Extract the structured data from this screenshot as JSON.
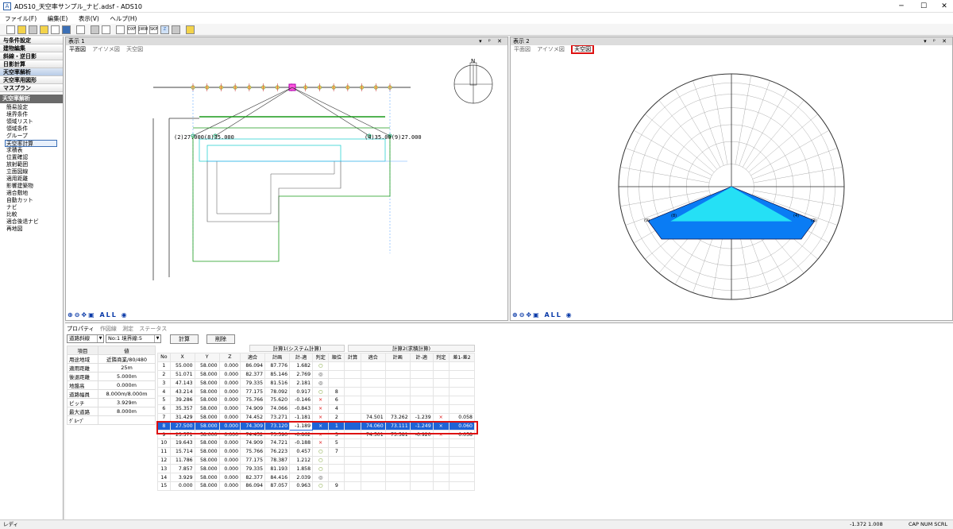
{
  "window": {
    "title": "ADS10_天空率サンプル_ナビ.adsf - ADS10",
    "app_icon": "A"
  },
  "menu": [
    "ファイル(F)",
    "編集(E)",
    "表示(V)",
    "ヘルプ(H)"
  ],
  "toolbar": {
    "labels": [
      "DXF",
      "JWW",
      "SKP",
      "Z"
    ]
  },
  "sidebar": {
    "headers": [
      "与条件設定",
      "建物編集",
      "斜線・逆日影",
      "日影計算",
      "天空率解析",
      "天空率用図形",
      "マスプラン"
    ],
    "section": "天空率解析",
    "items": [
      "簡易設定",
      "境界条件",
      "領域リスト",
      "領域条件",
      "グループ",
      "天空率計算",
      "求積表",
      "位置確認",
      "放射範囲",
      "立面図線",
      "適用距離",
      "影響建築物",
      "適合敷地",
      "自動カット",
      "ナビ",
      "比較",
      "適合後退ナビ",
      "再地図"
    ],
    "selected_index": 5
  },
  "view1": {
    "title": "表示 1",
    "tabs": [
      "平面図",
      "アイソメ図",
      "天空図"
    ],
    "active_tab": 0,
    "label_left": "(2)27.000(8)35.000",
    "label_right": "(4)35.00(9)27.000",
    "zoom_label": "ALL",
    "north": "N"
  },
  "view2": {
    "title": "表示 2",
    "tabs": [
      "平面図",
      "アイソメ図",
      "天空図"
    ],
    "active_tab": 2,
    "zoom_label": "ALL",
    "poly_labels": [
      "(9)",
      "(8)",
      "(4)",
      "(2)"
    ]
  },
  "props": {
    "tabs": [
      "プロパティ",
      "作図線",
      "測定",
      "ステータス"
    ],
    "combo1": "道路斜線",
    "combo2": "No:1 境界線:5",
    "calc_button": "計算",
    "delete_button": "削除",
    "left_headers": [
      "項目",
      "値"
    ],
    "left_rows": [
      [
        "用途地域",
        "近隣商業/80/480"
      ],
      [
        "適用距離",
        "25m"
      ],
      [
        "後退距離",
        "5.000m"
      ],
      [
        "地盤高",
        "0.000m"
      ],
      [
        "道路幅員",
        "8.000m/8.000m"
      ],
      [
        "ピッチ",
        "3.929m"
      ],
      [
        "最大道路",
        "8.000m"
      ],
      [
        "ｸﾞﾙｰﾌﾟ",
        ""
      ]
    ],
    "group1": "計算1(システム計算)",
    "group2": "計算2(求積計算)",
    "columns": [
      "No",
      "X",
      "Y",
      "Z",
      "適合",
      "計画",
      "計-適",
      "判定",
      "順位",
      "計算",
      "適合",
      "計画",
      "計-適",
      "判定",
      "差1-差2"
    ],
    "rows": [
      [
        "1",
        "55.000",
        "58.000",
        "0.000",
        "86.094",
        "87.776",
        "1.682",
        "○",
        "",
        "",
        "",
        "",
        "",
        "",
        ""
      ],
      [
        "2",
        "51.071",
        "58.000",
        "0.000",
        "82.377",
        "85.146",
        "2.769",
        "◎",
        "",
        "",
        "",
        "",
        "",
        "",
        ""
      ],
      [
        "3",
        "47.143",
        "58.000",
        "0.000",
        "79.335",
        "81.516",
        "2.181",
        "◎",
        "",
        "",
        "",
        "",
        "",
        "",
        ""
      ],
      [
        "4",
        "43.214",
        "58.000",
        "0.000",
        "77.175",
        "78.092",
        "0.917",
        "○",
        "8",
        "",
        "",
        "",
        "",
        "",
        ""
      ],
      [
        "5",
        "39.286",
        "58.000",
        "0.000",
        "75.766",
        "75.620",
        "-0.146",
        "×",
        "6",
        "",
        "",
        "",
        "",
        "",
        ""
      ],
      [
        "6",
        "35.357",
        "58.000",
        "0.000",
        "74.909",
        "74.066",
        "-0.843",
        "×",
        "4",
        "",
        "",
        "",
        "",
        "",
        ""
      ],
      [
        "7",
        "31.429",
        "58.000",
        "0.000",
        "74.452",
        "73.271",
        "-1.181",
        "×",
        "2",
        "",
        "74.501",
        "73.262",
        "-1.239",
        "×",
        "0.058"
      ],
      [
        "8",
        "27.500",
        "58.000",
        "0.000",
        "74.309",
        "73.120",
        "-1.189",
        "×",
        "1",
        "",
        "74.060",
        "73.111",
        "-1.249",
        "×",
        "0.060"
      ],
      [
        "9",
        "23.571",
        "58.000",
        "0.000",
        "74.452",
        "73.590",
        "-0.862",
        "×",
        "3",
        "",
        "74.501",
        "73.581",
        "-0.920",
        "×",
        "0.058"
      ],
      [
        "10",
        "19.643",
        "58.000",
        "0.000",
        "74.909",
        "74.721",
        "-0.188",
        "×",
        "5",
        "",
        "",
        "",
        "",
        "",
        ""
      ],
      [
        "11",
        "15.714",
        "58.000",
        "0.000",
        "75.766",
        "76.223",
        "0.457",
        "○",
        "7",
        "",
        "",
        "",
        "",
        "",
        ""
      ],
      [
        "12",
        "11.786",
        "58.000",
        "0.000",
        "77.175",
        "78.387",
        "1.212",
        "○",
        "",
        "",
        "",
        "",
        "",
        "",
        ""
      ],
      [
        "13",
        "7.857",
        "58.000",
        "0.000",
        "79.335",
        "81.193",
        "1.858",
        "○",
        "",
        "",
        "",
        "",
        "",
        "",
        ""
      ],
      [
        "14",
        "3.929",
        "58.000",
        "0.000",
        "82.377",
        "84.416",
        "2.039",
        "◎",
        "",
        "",
        "",
        "",
        "",
        "",
        ""
      ],
      [
        "15",
        "0.000",
        "58.000",
        "0.000",
        "86.094",
        "87.057",
        "0.963",
        "○",
        "9",
        "",
        "",
        "",
        "",
        "",
        ""
      ]
    ],
    "selected_row": 7
  },
  "status": {
    "text": "レディ",
    "coords": "-1.372  1.008",
    "indicators": "CAP NUM SCRL"
  }
}
